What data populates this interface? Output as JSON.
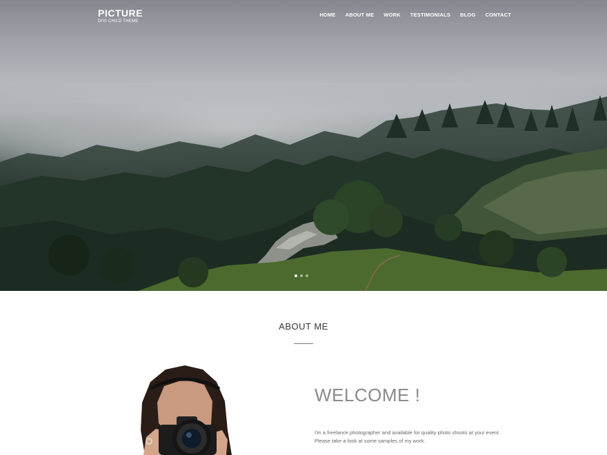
{
  "header": {
    "logo_title": "PICTURE",
    "logo_subtitle": "DIVI CHILD THEME",
    "nav": [
      {
        "label": "HOME"
      },
      {
        "label": "ABOUT ME"
      },
      {
        "label": "WORK"
      },
      {
        "label": "TESTIMONIALS"
      },
      {
        "label": "BLOG"
      },
      {
        "label": "CONTACT"
      }
    ]
  },
  "hero": {
    "slide_count": 3,
    "active_slide": 1
  },
  "about": {
    "title": "ABOUT ME",
    "welcome": "WELCOME !",
    "intro_lines": [
      "I'm a freelance photographer and available for quality photo shoots at your event.",
      "Please take a look at some samples of my work."
    ]
  },
  "colors": {
    "nav_text": "#ffffff",
    "welcome_text": "#8a8a8a",
    "body_text": "#666666"
  }
}
